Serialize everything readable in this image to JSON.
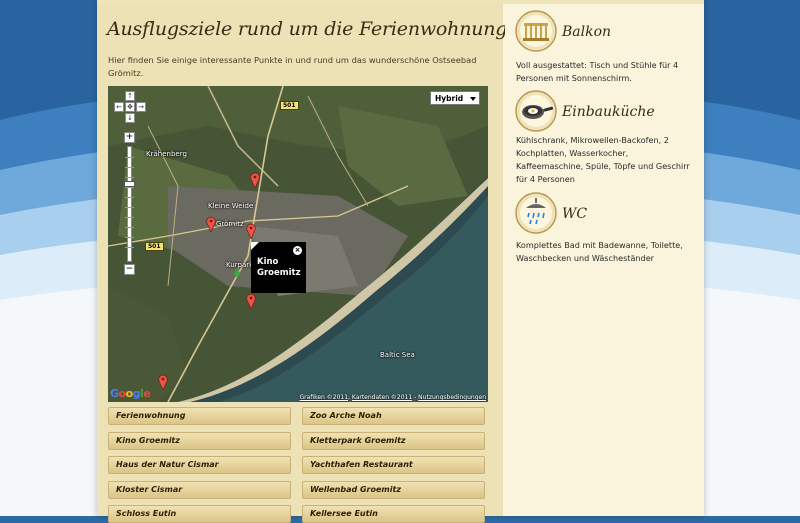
{
  "main": {
    "title": "Ausflugsziele rund um die Ferienwohnung in Grömitz",
    "intro": "Hier finden Sie einige interessante Punkte in und rund um das wunderschöne Ostseebad Grömitz."
  },
  "map": {
    "map_type_label": "Hybrid",
    "labels": {
      "krahenberg": "Krähenberg",
      "kleine_weide": "Kleine Weide",
      "gromitz": "Grömitz",
      "kurpark": "Kurpark",
      "baltic_sea": "Baltic Sea"
    },
    "road_shields": [
      "501",
      "501"
    ],
    "infobox_title": "Kino Groemitz",
    "attribution": {
      "grafiken": "Grafiken ©2011",
      "kartendaten": "Kartendaten ©2011",
      "separator": " - ",
      "nutzung": "Nutzungsbedingungen"
    },
    "google_logo": "Google"
  },
  "pois": [
    {
      "left": "Ferienwohnung",
      "right": "Zoo Arche Noah"
    },
    {
      "left": "Kino Groemitz",
      "right": "Kletterpark Groemitz"
    },
    {
      "left": "Haus der Natur Cismar",
      "right": "Yachthafen Restaurant"
    },
    {
      "left": "Kloster Cismar",
      "right": "Wellenbad Groemitz"
    },
    {
      "left": "Schloss Eutin",
      "right": "Kellersee Eutin"
    }
  ],
  "sidebar": {
    "features": [
      {
        "title": "Balkon",
        "text": "Voll ausgestattet: Tisch und Stühle für 4 Personen mit Sonnenschirm.",
        "icon": "balcony-icon"
      },
      {
        "title": "Einbauküche",
        "text": "Kühlschrank, Mikrowellen-Backofen, 2 Kochplatten, Wasserkocher, Kaffeemaschine, Spüle, Töpfe und Geschirr für 4 Personen",
        "icon": "frying-pan-icon"
      },
      {
        "title": "WC",
        "text": "Komplettes Bad mit Badewanne, Toilette, Waschbecken und Wäscheständer",
        "icon": "shower-icon"
      }
    ]
  }
}
